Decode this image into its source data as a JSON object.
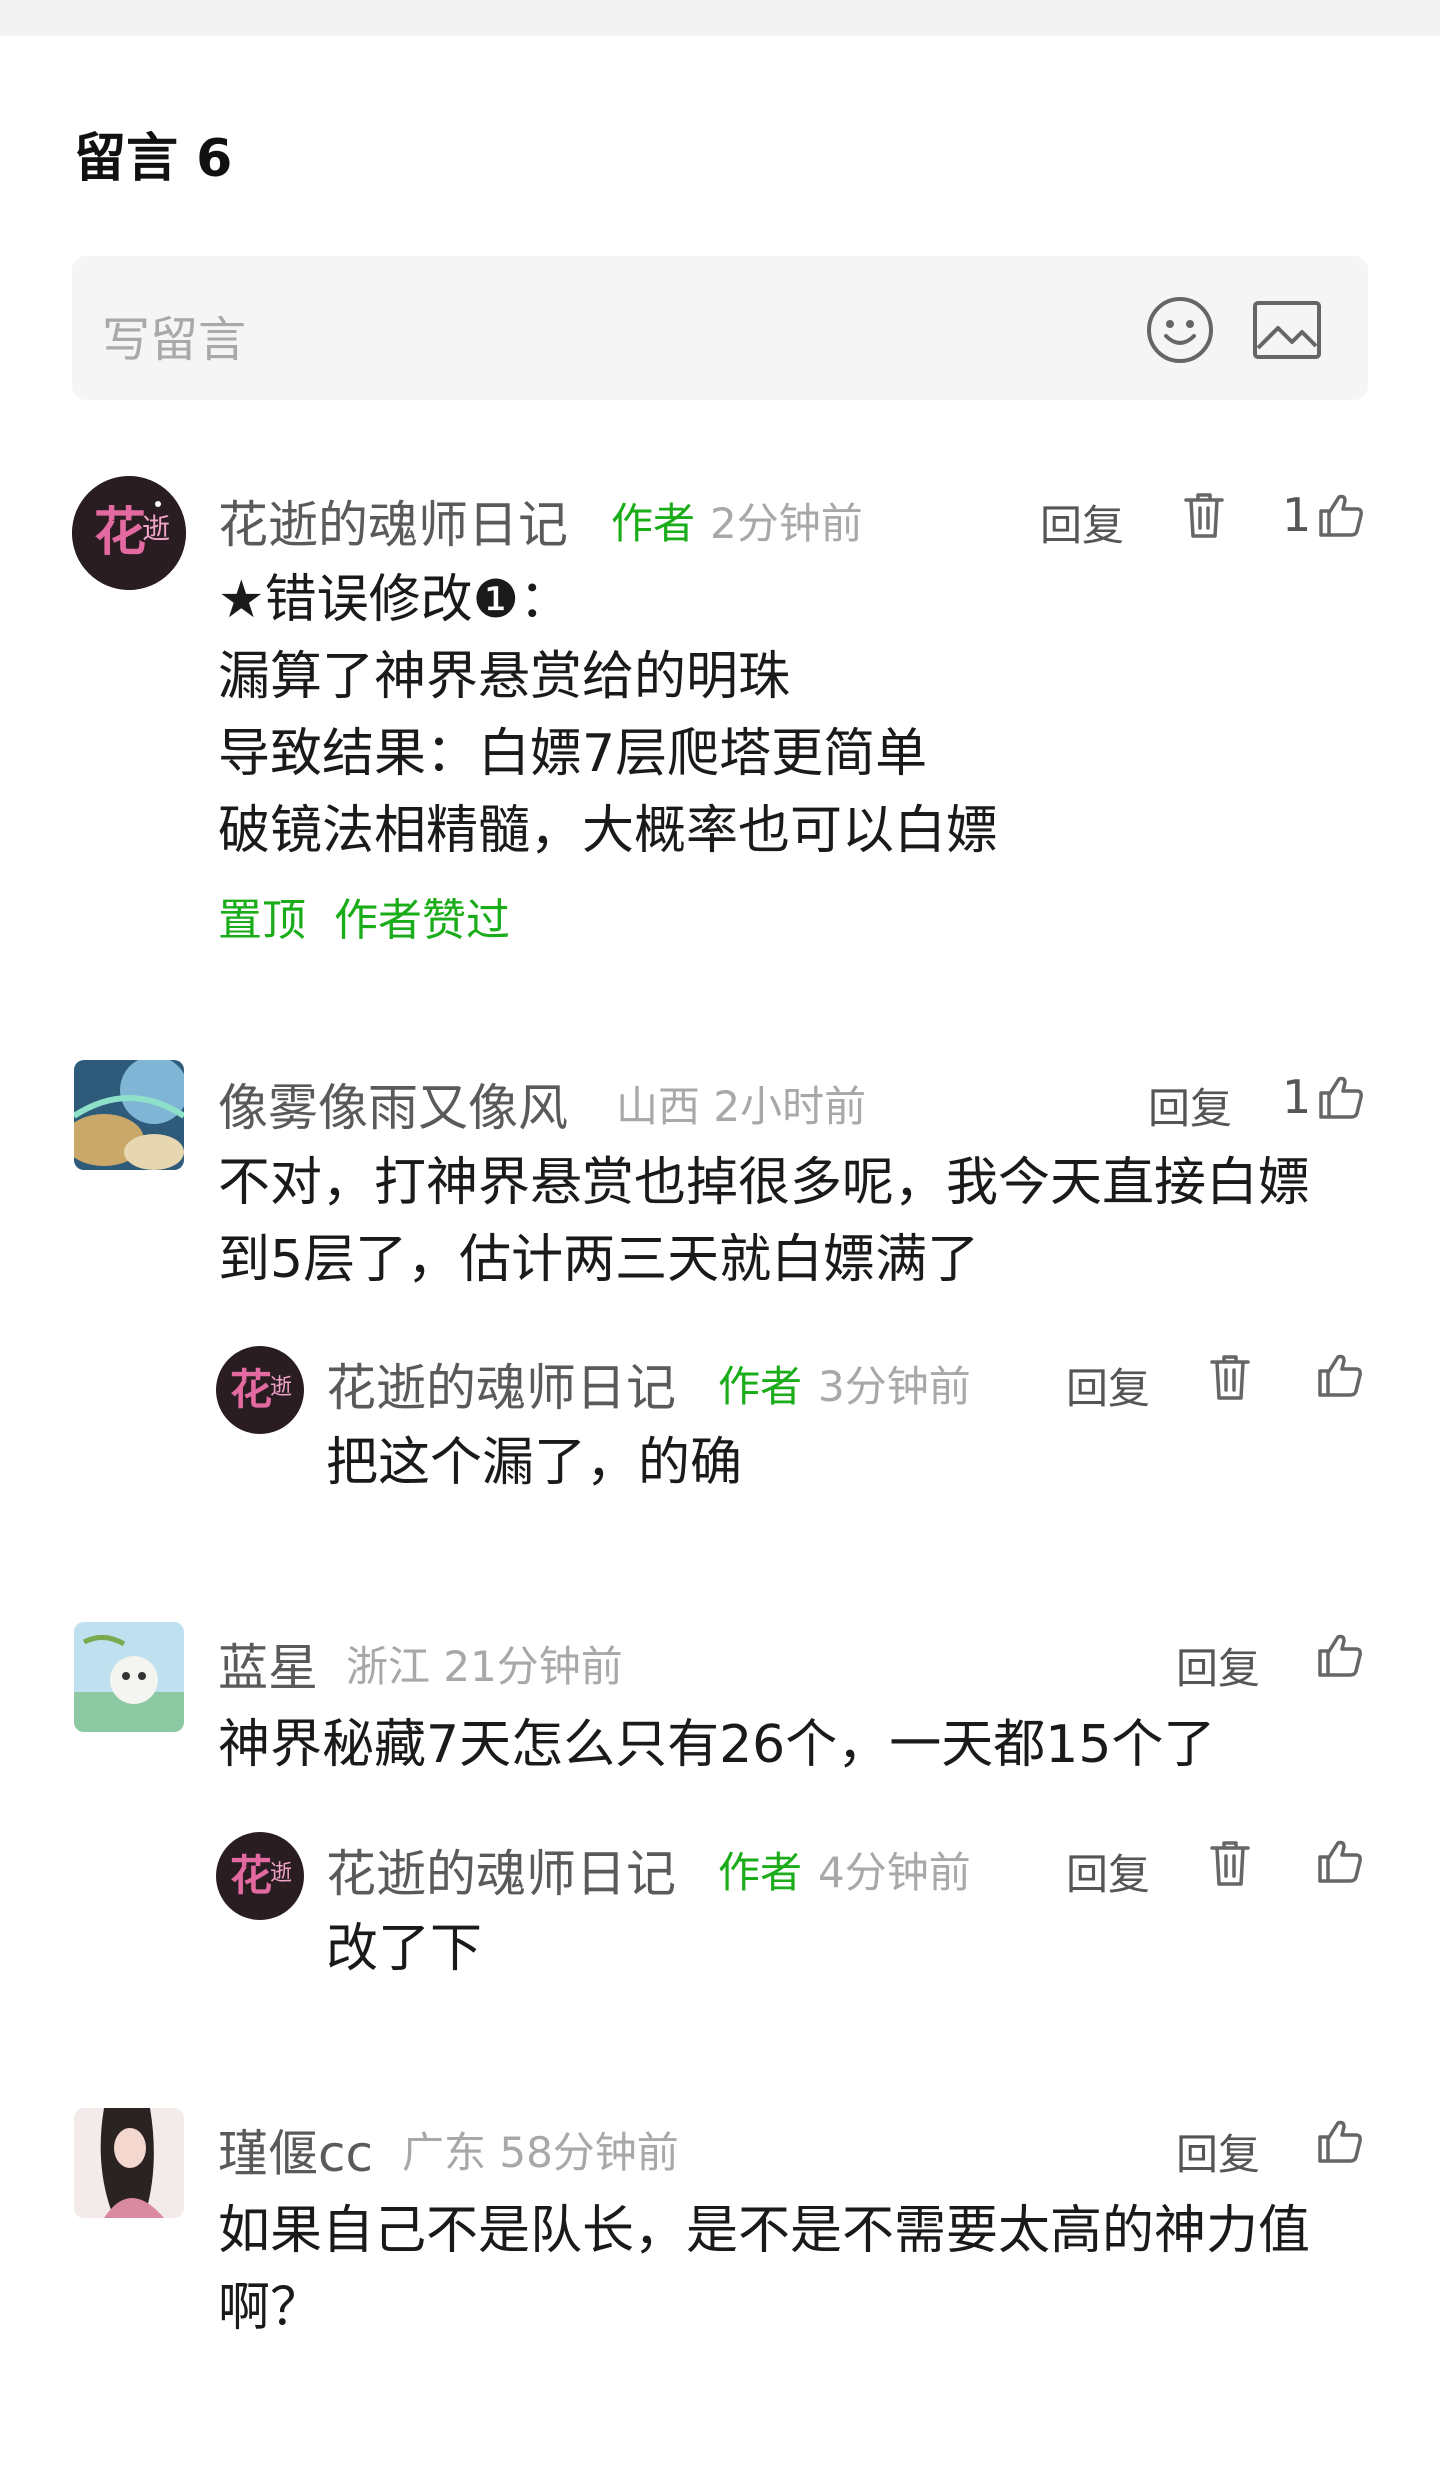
{
  "header": {
    "title": "留言 6"
  },
  "compose": {
    "placeholder": "写留言",
    "emoji_icon": "smiley-icon",
    "image_icon": "image-icon"
  },
  "comments": [
    {
      "user": "花逝的魂师日记",
      "author_tag": "作者",
      "meta": "2分钟前",
      "reply": "回复",
      "likes": "1",
      "lines": [
        "★错误修改❶：",
        "漏算了神界悬赏给的明珠",
        "导致结果：白嫖7层爬塔更简单",
        "破镜法相精髓，大概率也可以白嫖"
      ],
      "badges": "置顶  作者赞过"
    },
    {
      "user": "像雾像雨又像风",
      "meta": "山西 2小时前",
      "reply": "回复",
      "likes": "1",
      "lines": [
        "不对，打神界悬赏也掉很多呢，我今天直接白嫖",
        "到5层了，估计两三天就白嫖满了"
      ],
      "reply_item": {
        "user": "花逝的魂师日记",
        "author_tag": "作者",
        "meta": "3分钟前",
        "reply": "回复",
        "lines": [
          "把这个漏了，的确"
        ]
      }
    },
    {
      "user": "蓝星",
      "meta": "浙江 21分钟前",
      "reply": "回复",
      "lines": [
        "神界秘藏7天怎么只有26个，一天都15个了"
      ],
      "reply_item": {
        "user": "花逝的魂师日记",
        "author_tag": "作者",
        "meta": "4分钟前",
        "reply": "回复",
        "lines": [
          "改了下"
        ]
      }
    },
    {
      "user": "瑾偃cc",
      "meta": "广东 58分钟前",
      "reply": "回复",
      "lines": [
        "如果自己不是队长，是不是不需要太高的神力值",
        "啊？"
      ]
    }
  ],
  "colors": {
    "author_green": "#1aad19",
    "meta_gray": "#a8a8a8"
  }
}
